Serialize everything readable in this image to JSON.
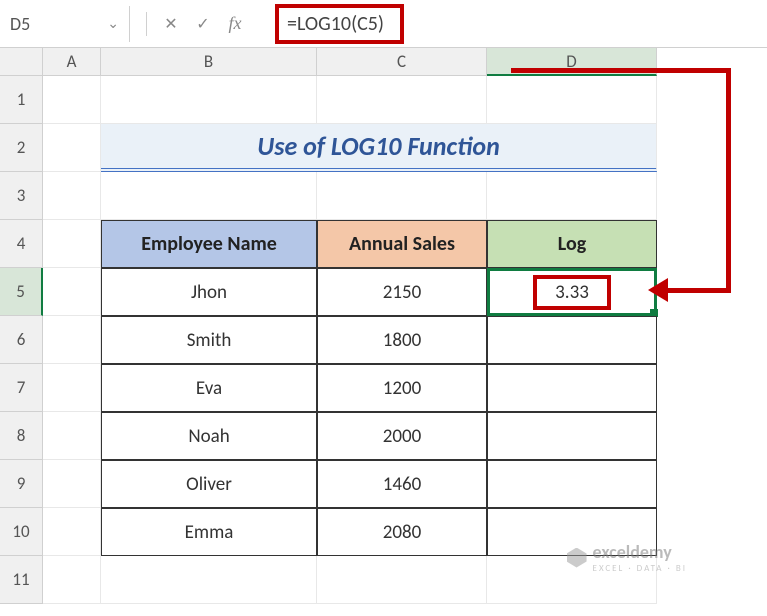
{
  "name_box": "D5",
  "formula": "=LOG10(C5)",
  "columns": [
    "A",
    "B",
    "C",
    "D"
  ],
  "rows": [
    "1",
    "2",
    "3",
    "4",
    "5",
    "6",
    "7",
    "8",
    "9",
    "10",
    "11"
  ],
  "title": "Use of LOG10 Function",
  "headers": {
    "b": "Employee Name",
    "c": "Annual Sales",
    "d": "Log"
  },
  "data": [
    {
      "name": "Jhon",
      "sales": "2150",
      "log": "3.33"
    },
    {
      "name": "Smith",
      "sales": "1800",
      "log": ""
    },
    {
      "name": "Eva",
      "sales": "1200",
      "log": ""
    },
    {
      "name": "Noah",
      "sales": "2000",
      "log": ""
    },
    {
      "name": "Oliver",
      "sales": "1460",
      "log": ""
    },
    {
      "name": "Emma",
      "sales": "2080",
      "log": ""
    }
  ],
  "watermark": {
    "brand": "exceldemy",
    "tagline": "EXCEL · DATA · BI"
  }
}
